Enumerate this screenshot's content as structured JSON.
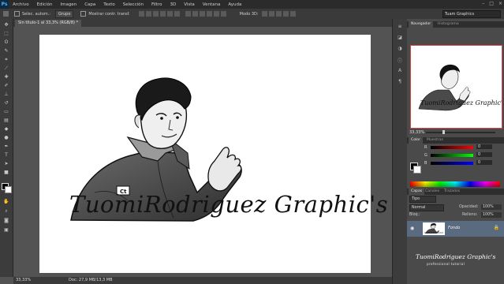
{
  "app": {
    "logo": "Ps"
  },
  "menu": [
    "Archivo",
    "Edición",
    "Imagen",
    "Capa",
    "Texto",
    "Selección",
    "Filtro",
    "3D",
    "Vista",
    "Ventana",
    "Ayuda"
  ],
  "window_controls": [
    "–",
    "□",
    "×"
  ],
  "options": {
    "auto_select_label": "Selec. autom.:",
    "auto_select_value": "Grupo",
    "transform_label": "Mostrar contr. transf.",
    "mode_label": "Modo 3D:",
    "workspace": "Tuam Graphics"
  },
  "document": {
    "tab_title": "Sin título-1 al 33,3% (RGB/8) *",
    "artwork_text": "TuomiRodriguez Graphic's"
  },
  "status": {
    "zoom": "33,33%",
    "doc_info": "Doc: 27,9 MB/13,3 MB"
  },
  "navigator": {
    "tabs": [
      "Navegador",
      "Histograma"
    ],
    "zoom": "33,33%",
    "thumb_text": "TuomiRodriguez Graphic's"
  },
  "color_panel": {
    "tabs": [
      "Color",
      "Muestras"
    ],
    "rows": [
      {
        "label": "R",
        "value": "0"
      },
      {
        "label": "G",
        "value": "0"
      },
      {
        "label": "B",
        "value": "0"
      }
    ]
  },
  "layers_panel": {
    "tabs": [
      "Capas",
      "Canales",
      "Trazados"
    ],
    "filter": "Tipo",
    "blend_mode": "Normal",
    "opacity_label": "Opacidad:",
    "opacity": "100%",
    "lock_label": "Bloq.:",
    "fill_label": "Relleno:",
    "fill": "100%",
    "layers": [
      {
        "name": "Fondo",
        "visible": true,
        "locked": true
      }
    ]
  },
  "watermark": {
    "name": "TuomiRodriguez Graphic's",
    "sub": "professional tutorial"
  },
  "colors": {
    "accent_selection": "#5a6b80",
    "navigator_frame": "#d34a4a",
    "ui_dark": "#2b2b2b",
    "ui_mid": "#535353"
  }
}
